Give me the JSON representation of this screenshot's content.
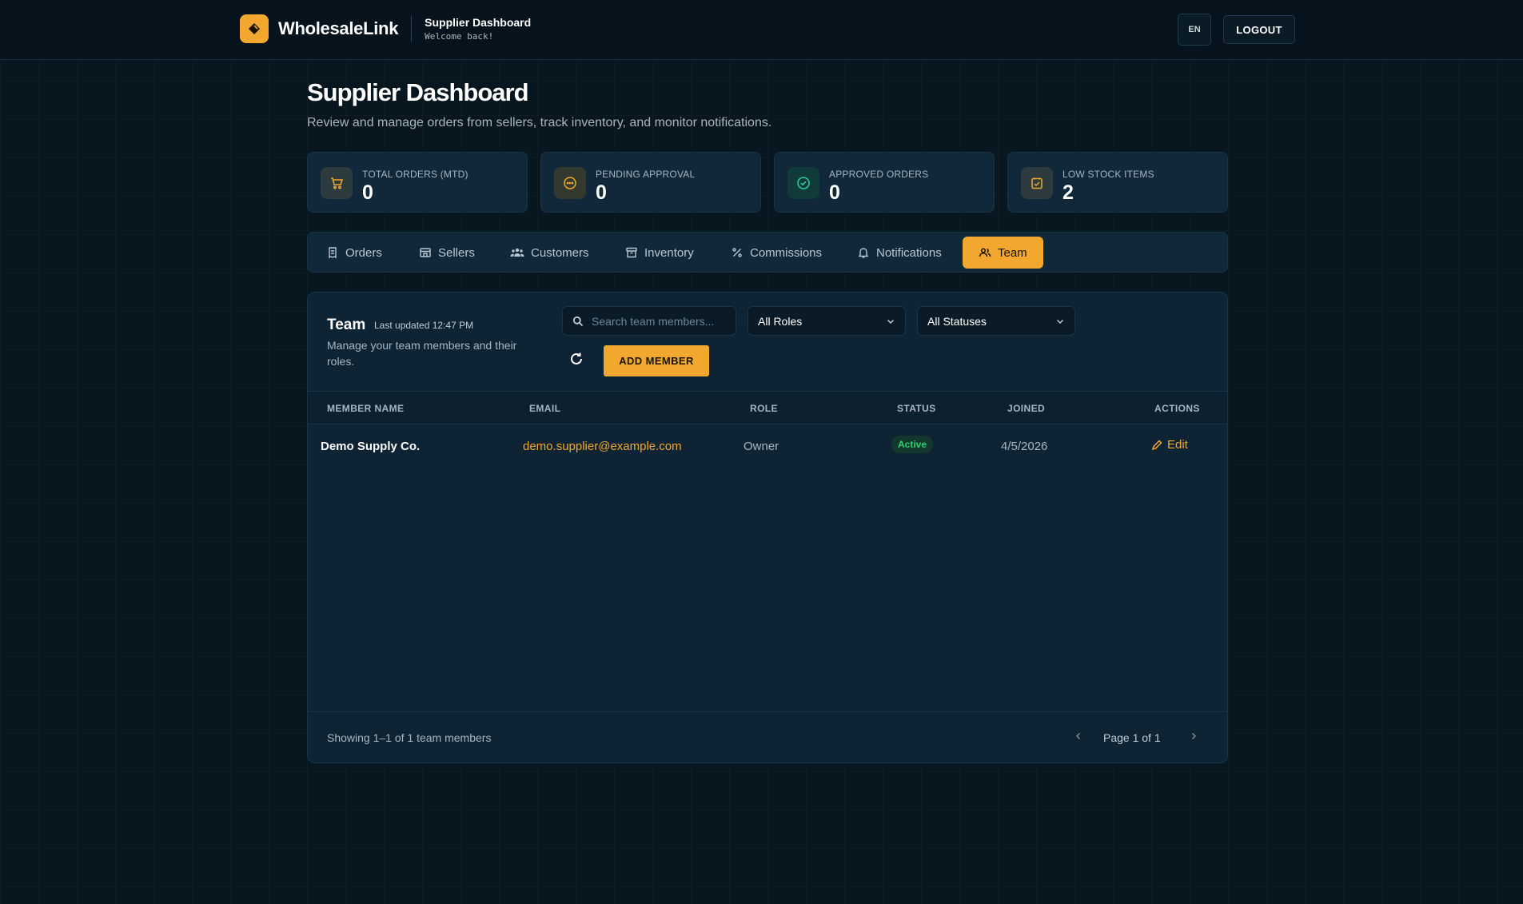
{
  "header": {
    "brand_name": "WholesaleLink",
    "section_title": "Supplier Dashboard",
    "welcome": "Welcome back!",
    "language": "EN",
    "logout_label": "LOGOUT"
  },
  "page": {
    "title": "Supplier Dashboard",
    "description": "Review and manage orders from sellers, track inventory, and monitor notifications."
  },
  "stats": [
    {
      "label": "TOTAL ORDERS (MTD)",
      "value": "0",
      "icon": "cart-icon"
    },
    {
      "label": "PENDING APPROVAL",
      "value": "0",
      "icon": "pending-icon"
    },
    {
      "label": "APPROVED ORDERS",
      "value": "0",
      "icon": "check-circle-icon"
    },
    {
      "label": "LOW STOCK ITEMS",
      "value": "2",
      "icon": "clipboard-alert-icon"
    }
  ],
  "tabs": [
    {
      "label": "Orders",
      "icon": "receipt-icon"
    },
    {
      "label": "Sellers",
      "icon": "store-icon"
    },
    {
      "label": "Customers",
      "icon": "users-icon"
    },
    {
      "label": "Inventory",
      "icon": "archive-icon"
    },
    {
      "label": "Commissions",
      "icon": "percent-icon"
    },
    {
      "label": "Notifications",
      "icon": "bell-icon"
    },
    {
      "label": "Team",
      "icon": "team-icon",
      "active": true
    }
  ],
  "team": {
    "title": "Team",
    "last_updated": "Last updated 12:47 PM",
    "description": "Manage your team members and their roles.",
    "search_placeholder": "Search team members...",
    "role_filter": "All Roles",
    "status_filter": "All Statuses",
    "add_label": "ADD MEMBER",
    "columns": [
      "MEMBER NAME",
      "EMAIL",
      "ROLE",
      "STATUS",
      "JOINED",
      "ACTIONS"
    ],
    "rows": [
      {
        "name": "Demo Supply Co.",
        "email": "demo.supplier@example.com",
        "role": "Owner",
        "status": "Active",
        "joined": "4/5/2026",
        "action": "Edit"
      }
    ],
    "footer_text": "Showing 1–1 of 1 team members",
    "page_text": "Page 1 of 1"
  },
  "colors": {
    "accent": "#f2a82e",
    "background": "#08161f",
    "card": "#10283a",
    "status_active": "#2fcf74"
  }
}
